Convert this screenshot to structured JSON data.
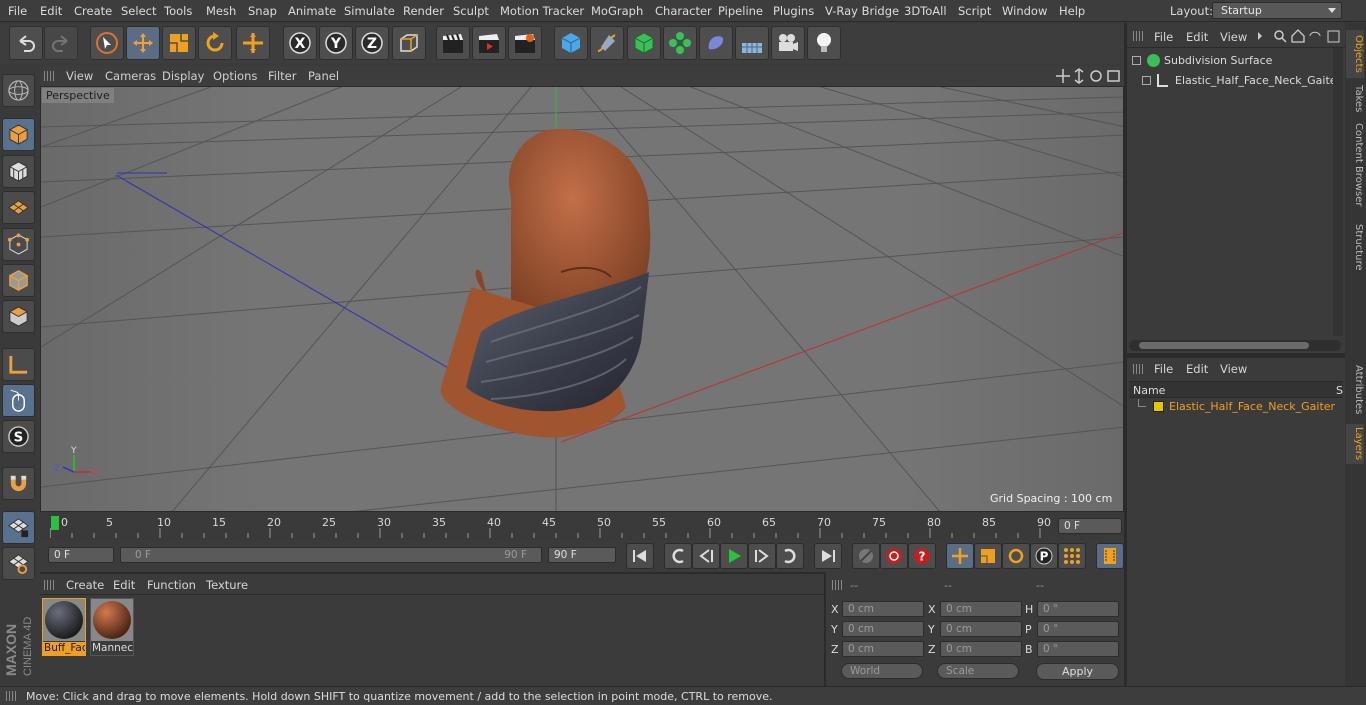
{
  "menubar": {
    "items": [
      "File",
      "Edit",
      "Create",
      "Select",
      "Tools",
      "Mesh",
      "Snap",
      "Animate",
      "Simulate",
      "Render",
      "Sculpt",
      "Motion Tracker",
      "MoGraph",
      "Character",
      "Pipeline",
      "Plugins",
      "V-Ray Bridge",
      "3DToAll",
      "Script",
      "Window",
      "Help"
    ],
    "layout_label": "Layout:",
    "layout_value": "Startup"
  },
  "viewport": {
    "menu": [
      "View",
      "Cameras",
      "Display",
      "Options",
      "Filter",
      "Panel"
    ],
    "label": "Perspective",
    "grid_spacing": "Grid Spacing : 100 cm",
    "axis_x": "X",
    "axis_y": "Y",
    "axis_z": "Z"
  },
  "timeline": {
    "ticks": [
      "0",
      "5",
      "10",
      "15",
      "20",
      "25",
      "30",
      "35",
      "40",
      "45",
      "50",
      "55",
      "60",
      "65",
      "70",
      "75",
      "80",
      "85",
      "90"
    ],
    "current_frame": "0 F",
    "start_field": "0 F",
    "range_start": "0 F",
    "range_end": "90 F",
    "end_field": "90 F"
  },
  "materials": {
    "menu": [
      "Create",
      "Edit",
      "Function",
      "Texture"
    ],
    "items": [
      {
        "name": "Buff_Fac",
        "selected": true
      },
      {
        "name": "Mannec",
        "selected": false
      }
    ]
  },
  "coords": {
    "headers": [
      "--",
      "--",
      "--"
    ],
    "rows": [
      {
        "a": "X",
        "av": "0 cm",
        "b": "X",
        "bv": "0 cm",
        "c": "H",
        "cv": "0 °"
      },
      {
        "a": "Y",
        "av": "0 cm",
        "b": "Y",
        "bv": "0 cm",
        "c": "P",
        "cv": "0 °"
      },
      {
        "a": "Z",
        "av": "0 cm",
        "b": "Z",
        "bv": "0 cm",
        "c": "B",
        "cv": "0 °"
      }
    ],
    "mode1": "World",
    "mode2": "Scale",
    "apply": "Apply"
  },
  "objects": {
    "menu": [
      "File",
      "Edit",
      "View"
    ],
    "items": [
      "Subdivision Surface",
      "Elastic_Half_Face_Neck_Gaiter"
    ]
  },
  "layers": {
    "menu": [
      "File",
      "Edit",
      "View"
    ],
    "col_name": "Name",
    "col_s": "S",
    "items": [
      "Elastic_Half_Face_Neck_Gaiter"
    ]
  },
  "side_tabs": [
    "Objects",
    "Takes",
    "Content Browser",
    "Structure"
  ],
  "side_tabs2": [
    "Attributes",
    "Layers"
  ],
  "brand": {
    "maxon": "MAXON",
    "product": "CINEMA 4D"
  },
  "status": "Move: Click and drag to move elements. Hold down SHIFT to quantize movement / add to the selection in point mode, CTRL to remove.",
  "colors": {
    "accent": "#f0a020",
    "selected_layer": "#e6c400",
    "axis_x": "#c03030",
    "axis_y": "#30c030",
    "axis_z": "#3030c0"
  }
}
